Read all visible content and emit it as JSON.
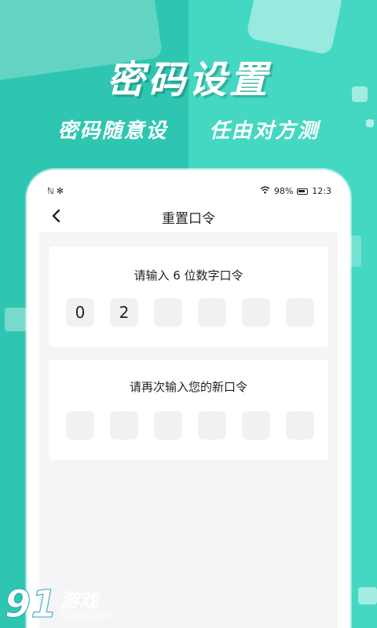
{
  "promo": {
    "headline": "密码设置",
    "sub_left": "密码随意设",
    "sub_right": "任由对方测"
  },
  "statusbar": {
    "left_icons": "ℕ✻",
    "battery": "98%",
    "time": "12:3"
  },
  "navbar": {
    "title": "重置口令"
  },
  "card1": {
    "title": "请输入 6 位数字口令",
    "digits": [
      "0",
      "2",
      "",
      "",
      "",
      ""
    ]
  },
  "card2": {
    "title": "请再次输入您的新口令",
    "digits": [
      "",
      "",
      "",
      "",
      "",
      ""
    ]
  },
  "watermark": {
    "number": "91",
    "name": "游戏",
    "url": "91danji.com"
  },
  "colors": {
    "teal_left": "#2fc6b1",
    "teal_right": "#44d8c3",
    "screen_bg": "#f5f5f7"
  }
}
